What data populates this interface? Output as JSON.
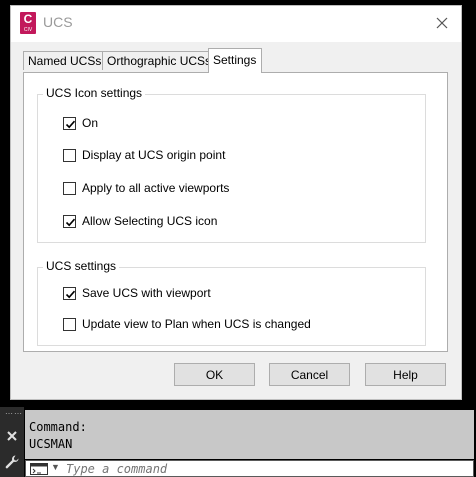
{
  "window": {
    "title": "UCS",
    "icon_letter": "C",
    "icon_sub": "CIV"
  },
  "tabs": [
    {
      "label": "Named UCSs",
      "active": false
    },
    {
      "label": "Orthographic UCSs",
      "active": false
    },
    {
      "label": "Settings",
      "active": true
    }
  ],
  "icon_settings": {
    "title": "UCS Icon settings",
    "options": [
      {
        "label": "On",
        "checked": true
      },
      {
        "label": "Display at UCS origin point",
        "checked": false
      },
      {
        "label": "Apply to all active viewports",
        "checked": false
      },
      {
        "label": "Allow Selecting UCS icon",
        "checked": true
      }
    ]
  },
  "ucs_settings": {
    "title": "UCS settings",
    "options": [
      {
        "label": "Save UCS with viewport",
        "checked": true
      },
      {
        "label": "Update view to Plan when UCS is changed",
        "checked": false
      }
    ]
  },
  "buttons": {
    "ok": "OK",
    "cancel": "Cancel",
    "help": "Help"
  },
  "command": {
    "history": [
      "Command:",
      "UCSMAN"
    ],
    "placeholder": "Type a command"
  },
  "colors": {
    "app_icon": "#c2185b",
    "dialog_bg": "#f0f0f0",
    "history_bg": "#c8c8c8"
  }
}
